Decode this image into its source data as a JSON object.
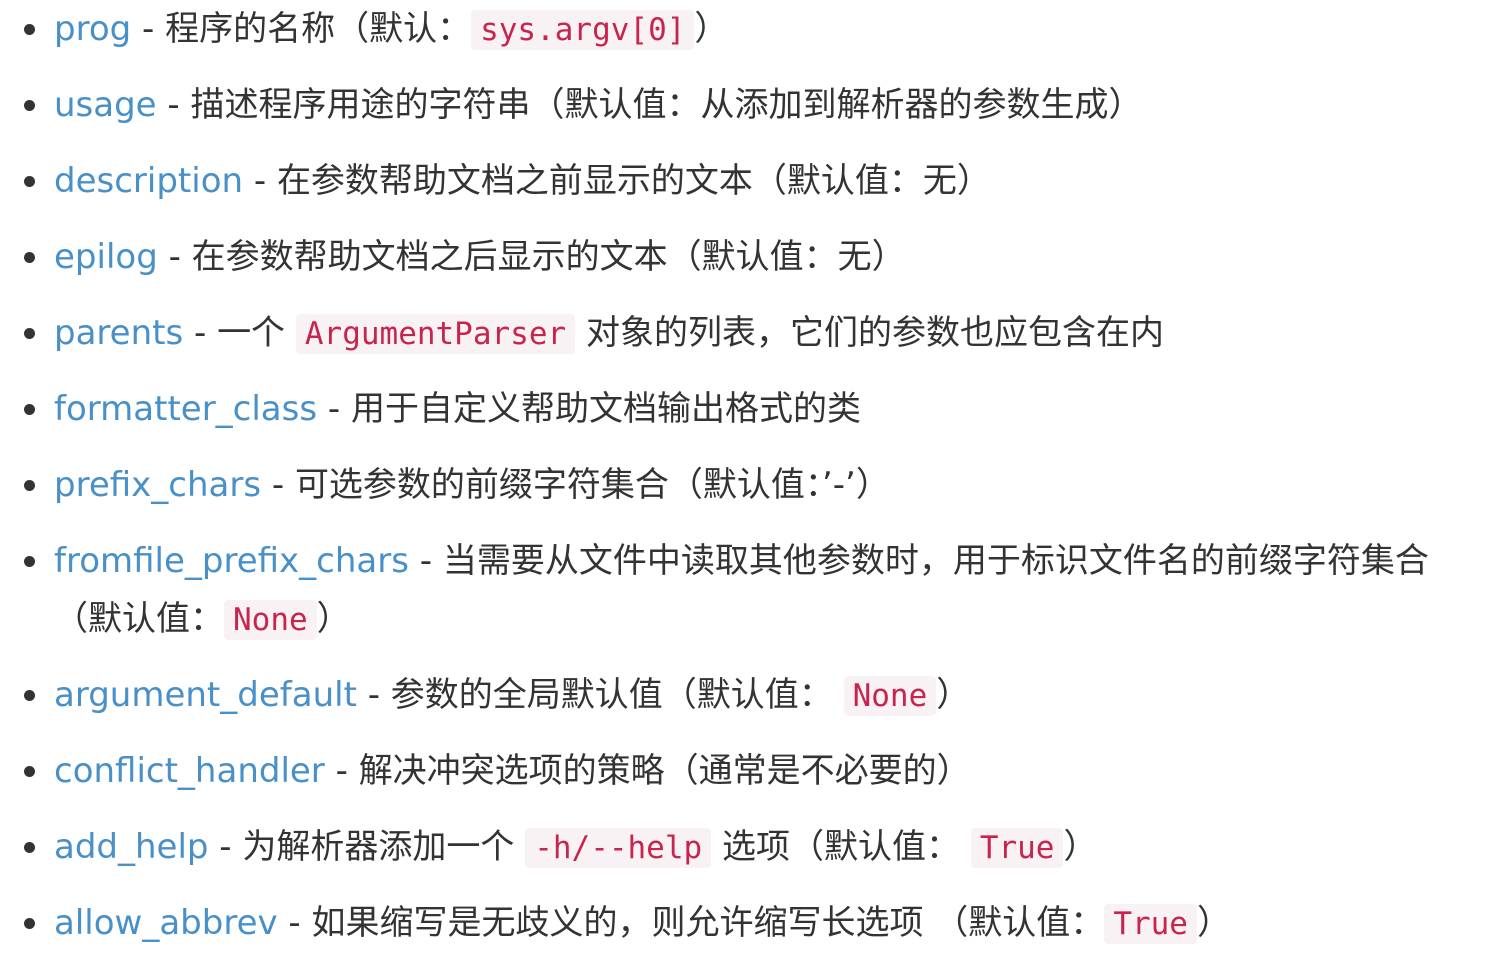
{
  "params": [
    {
      "name": "prog",
      "sep": " - ",
      "text_before": "程序的名称（默认：",
      "code": "sys.argv[0]",
      "text_after": "）"
    },
    {
      "name": "usage",
      "sep": " - ",
      "text_before": "描述程序用途的字符串（默认值：从添加到解析器的参数生成）",
      "code": "",
      "text_after": ""
    },
    {
      "name": "description",
      "sep": " - ",
      "text_before": "在参数帮助文档之前显示的文本（默认值：无）",
      "code": "",
      "text_after": ""
    },
    {
      "name": "epilog",
      "sep": " - ",
      "text_before": "在参数帮助文档之后显示的文本（默认值：无）",
      "code": "",
      "text_after": ""
    },
    {
      "name": "parents",
      "sep": " - ",
      "text_before": "一个 ",
      "code": "ArgumentParser",
      "text_after": " 对象的列表，它们的参数也应包含在内"
    },
    {
      "name": "formatter_class",
      "sep": " - ",
      "text_before": "用于自定义帮助文档输出格式的类",
      "code": "",
      "text_after": ""
    },
    {
      "name": "prefix_chars",
      "sep": " - ",
      "text_before": "可选参数的前缀字符集合（默认值：’-’）",
      "code": "",
      "text_after": ""
    },
    {
      "name": "fromfile_prefix_chars",
      "sep": " - ",
      "text_before": "当需要从文件中读取其他参数时，用于标识文件名的前缀字符集合（默认值：",
      "code": "None",
      "text_after": "）"
    },
    {
      "name": "argument_default",
      "sep": " - ",
      "text_before": "参数的全局默认值（默认值： ",
      "code": "None",
      "text_after": "）"
    },
    {
      "name": "conflict_handler",
      "sep": " - ",
      "text_before": "解决冲突选项的策略（通常是不必要的）",
      "code": "",
      "text_after": ""
    },
    {
      "name": "add_help",
      "sep": " - ",
      "text_before": "为解析器添加一个 ",
      "code": "-h/--help",
      "text_after": " 选项（默认值： ",
      "code2": "True",
      "text_after2": "）"
    },
    {
      "name": "allow_abbrev",
      "sep": " - ",
      "text_before": "如果缩写是无歧义的，则允许缩写长选项 （默认值：",
      "code": "True",
      "text_after": "）"
    }
  ],
  "colors": {
    "link": "#4a90c8",
    "text": "#333333",
    "code_text": "#c7254e",
    "code_bg": "#f9f2f4"
  }
}
